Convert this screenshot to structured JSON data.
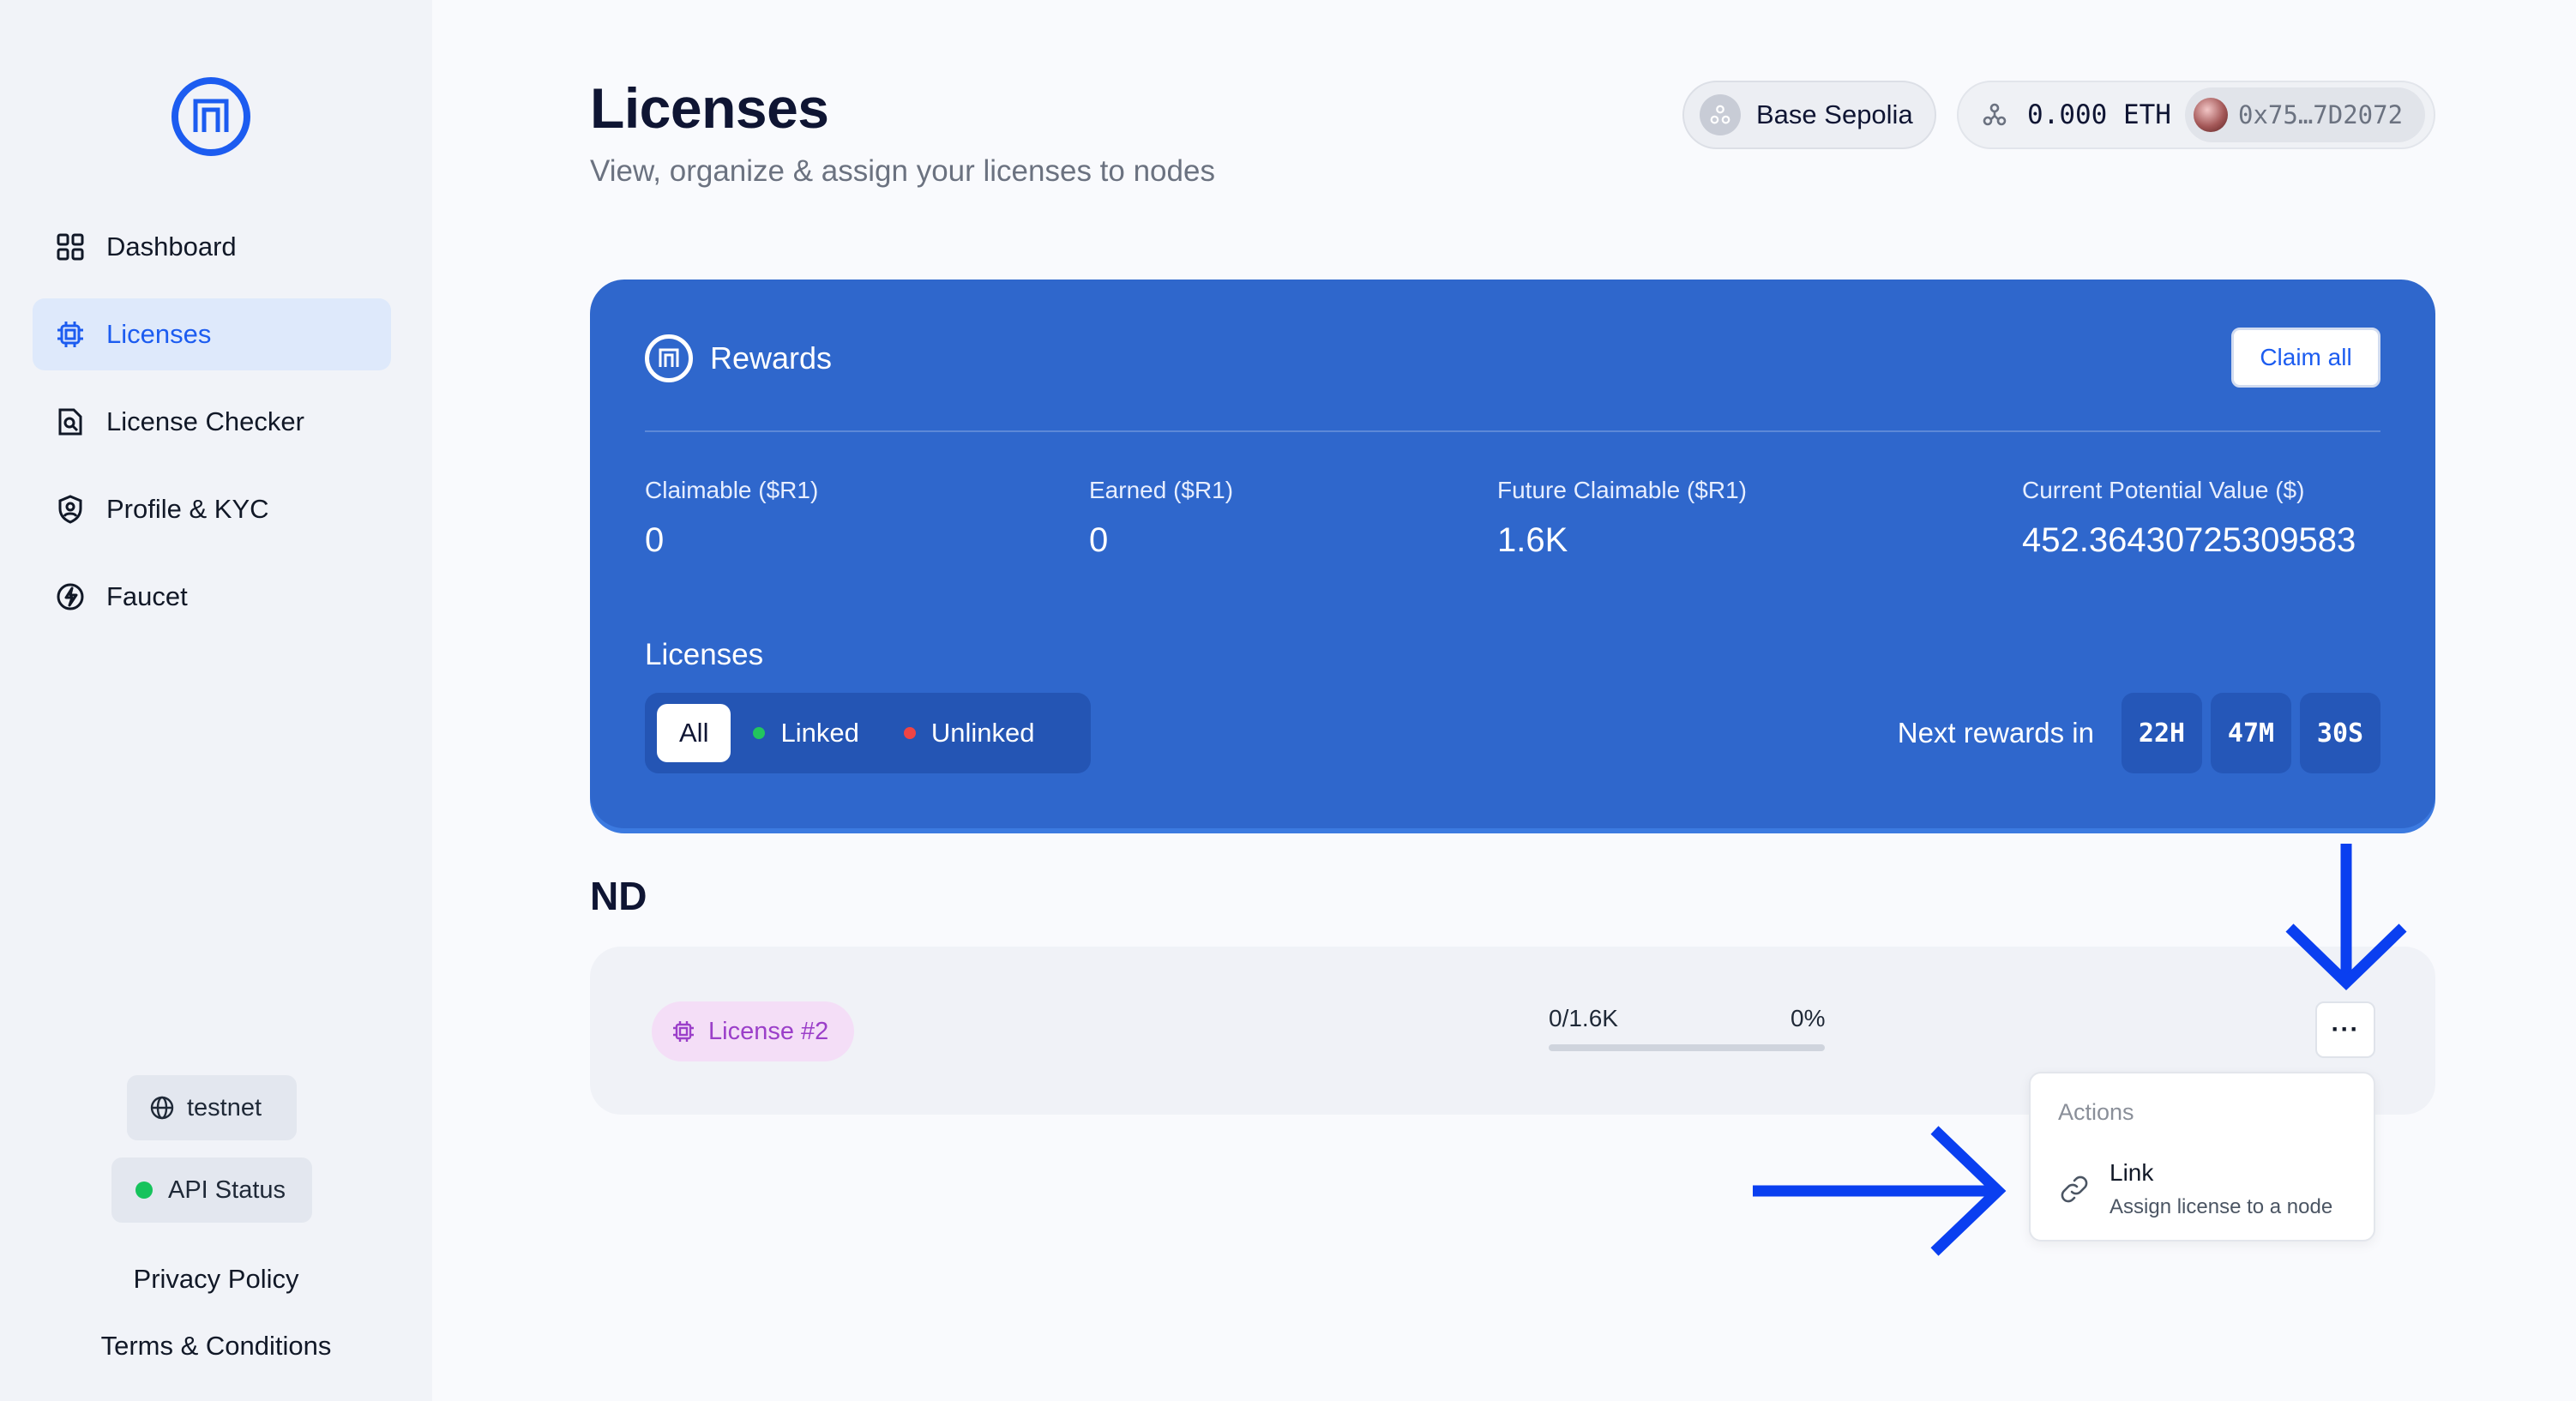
{
  "sidebar": {
    "items": [
      {
        "label": "Dashboard",
        "icon": "dashboard-grid-icon"
      },
      {
        "label": "Licenses",
        "icon": "chip-icon",
        "active": true
      },
      {
        "label": "License Checker",
        "icon": "license-search-icon"
      },
      {
        "label": "Profile & KYC",
        "icon": "shield-user-icon"
      },
      {
        "label": "Faucet",
        "icon": "bolt-icon"
      }
    ],
    "network_label": "testnet",
    "api_status_label": "API Status",
    "privacy_label": "Privacy Policy",
    "terms_label": "Terms & Conditions"
  },
  "header": {
    "title": "Licenses",
    "subtitle": "View, organize & assign your licenses to nodes",
    "network_button": "Base Sepolia",
    "balance": "0.000 ETH",
    "address": "0x75…7D2072"
  },
  "rewards": {
    "title": "Rewards",
    "claim_label": "Claim all",
    "stats": [
      {
        "label": "Claimable ($R1)",
        "value": "0"
      },
      {
        "label": "Earned ($R1)",
        "value": "0"
      },
      {
        "label": "Future Claimable ($R1)",
        "value": "1.6K"
      },
      {
        "label": "Current Potential Value ($)",
        "value": "452.36430725309583"
      }
    ],
    "licenses_label": "Licenses",
    "filters": [
      {
        "label": "All",
        "active": true
      },
      {
        "label": "Linked",
        "dot_color": "#22c55e"
      },
      {
        "label": "Unlinked",
        "dot_color": "#ef4444"
      }
    ],
    "next_label": "Next rewards in",
    "countdown": [
      "22H",
      "47M",
      "30S"
    ]
  },
  "section": {
    "title": "ND",
    "license": {
      "tag": "License #2",
      "progress_text": "0/1.6K",
      "progress_percent": "0%",
      "progress_fraction": 0,
      "more_label": "···"
    }
  },
  "menu": {
    "header": "Actions",
    "item_title": "Link",
    "item_desc": "Assign license to a node"
  },
  "colors": {
    "accent": "#1c5cf0",
    "rewards_bg": "#2f67cc",
    "tag_bg": "#f4def7",
    "tag_text": "#9b3fc9",
    "annotation_arrow": "#0a3ff0"
  }
}
